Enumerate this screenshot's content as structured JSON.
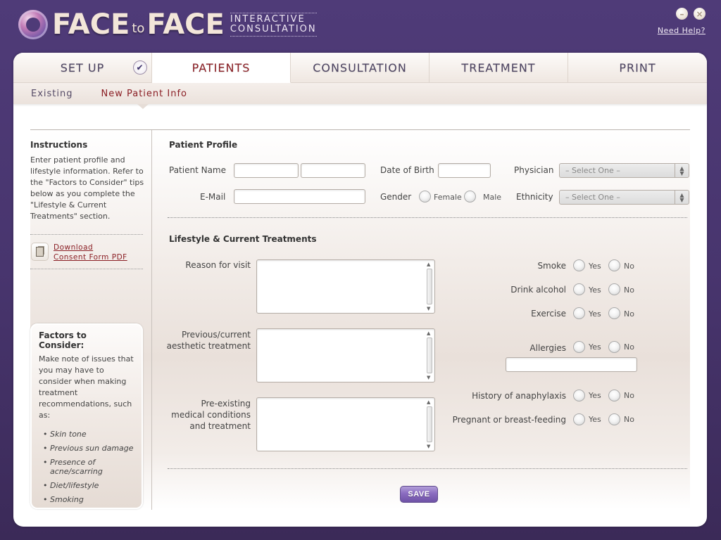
{
  "header": {
    "logo_main_1": "FACE",
    "logo_to": "to",
    "logo_main_2": "FACE",
    "logo_sub_1": "INTERACTIVE",
    "logo_sub_2": "CONSULTATION",
    "minimize_glyph": "–",
    "close_glyph": "×",
    "help_link": "Need Help?"
  },
  "tabs": [
    {
      "label": "SET UP",
      "completed": true,
      "check_glyph": "✔"
    },
    {
      "label": "PATIENTS",
      "active": true
    },
    {
      "label": "CONSULTATION"
    },
    {
      "label": "TREATMENT"
    },
    {
      "label": "PRINT"
    }
  ],
  "subtabs": [
    {
      "label": "Existing"
    },
    {
      "label": "New Patient Info",
      "active": true
    }
  ],
  "sidebar": {
    "instructions_title": "Instructions",
    "instructions_text": "Enter patient profile and lifestyle information. Refer to the \"Factors to Consider\" tips below as you complete the \"Lifestyle & Current Treatments\" section.",
    "download_line1": "Download",
    "download_line2": "Consent Form PDF",
    "factors_title": "Factors to Consider:",
    "factors_text": "Make note of issues that you may have to consider when making treatment recommendations, such as:",
    "factors_items": [
      "Skin tone",
      "Previous sun damage",
      "Presence of acne/scarring",
      "Diet/lifestyle",
      "Smoking"
    ]
  },
  "profile": {
    "title": "Patient Profile",
    "patient_name_label": "Patient Name",
    "first_name_value": "",
    "last_name_value": "",
    "dob_label": "Date of Birth",
    "dob_value": "",
    "physician_label": "Physician",
    "physician_value": "– Select One –",
    "email_label": "E-Mail",
    "email_value": "",
    "gender_label": "Gender",
    "gender_options": [
      "Female",
      "Male"
    ],
    "ethnicity_label": "Ethnicity",
    "ethnicity_value": "– Select One –",
    "arrow_up": "▲",
    "arrow_down": "▼"
  },
  "lifestyle": {
    "title": "Lifestyle & Current Treatments",
    "textareas": [
      {
        "label_lines": [
          "Reason for visit"
        ],
        "value": ""
      },
      {
        "label_lines": [
          "Previous/current",
          "aesthetic treatment"
        ],
        "value": ""
      },
      {
        "label_lines": [
          "Pre-existing",
          "medical conditions",
          "and treatment"
        ],
        "value": ""
      }
    ],
    "questions": [
      {
        "label": "Smoke",
        "yes": "Yes",
        "no": "No"
      },
      {
        "label": "Drink alcohol",
        "yes": "Yes",
        "no": "No"
      },
      {
        "label": "Exercise",
        "yes": "Yes",
        "no": "No"
      },
      {
        "label": "Allergies",
        "yes": "Yes",
        "no": "No"
      },
      {
        "label": "History of anaphylaxis",
        "yes": "Yes",
        "no": "No"
      },
      {
        "label": "Pregnant or breast-feeding",
        "yes": "Yes",
        "no": "No"
      }
    ],
    "allergies_detail_value": ""
  },
  "actions": {
    "save_label": "SAVE"
  },
  "colors": {
    "brand_purple": "#4f3b78",
    "active_red": "#8a1e24",
    "save_purple": "#8a6cc0"
  }
}
